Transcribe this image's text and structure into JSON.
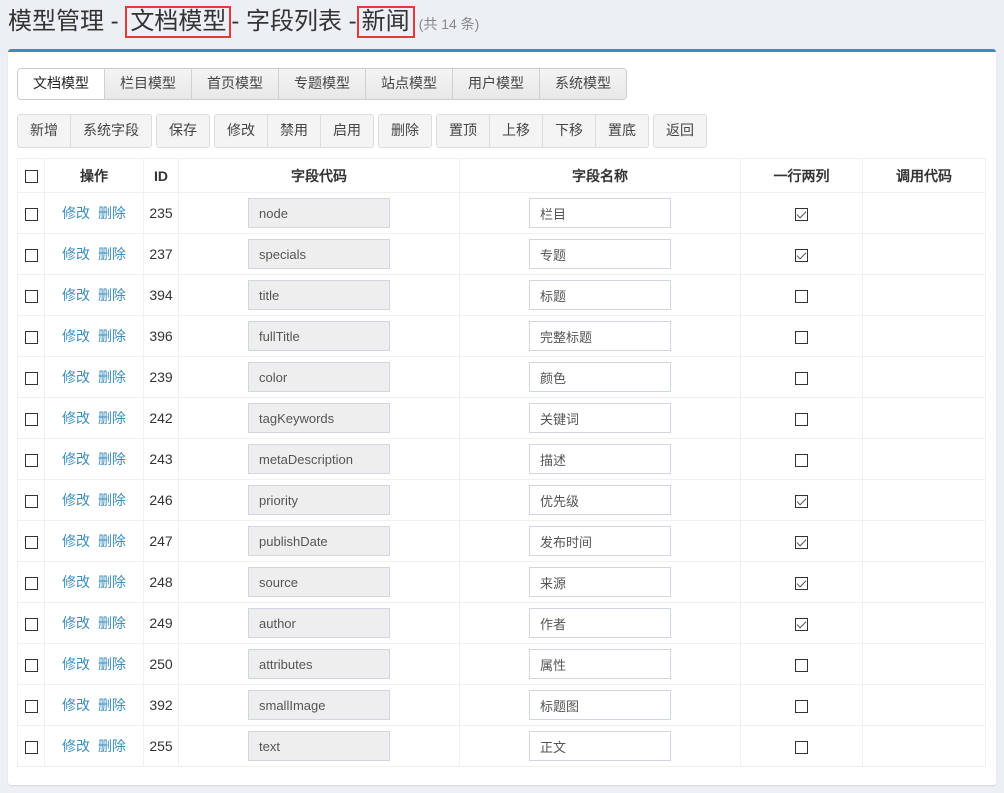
{
  "header": {
    "part1": "模型管理 - ",
    "model": "文档模型",
    "part2": "- 字段列表 -",
    "channel": "新闻",
    "count": "(共 14 条)"
  },
  "tabs": [
    {
      "label": "文档模型",
      "active": true
    },
    {
      "label": "栏目模型",
      "active": false
    },
    {
      "label": "首页模型",
      "active": false
    },
    {
      "label": "专题模型",
      "active": false
    },
    {
      "label": "站点模型",
      "active": false
    },
    {
      "label": "用户模型",
      "active": false
    },
    {
      "label": "系统模型",
      "active": false
    }
  ],
  "toolbar": {
    "groups": [
      [
        {
          "label": "新增",
          "name": "add-button"
        },
        {
          "label": "系统字段",
          "name": "system-fields-button"
        }
      ],
      [
        {
          "label": "保存",
          "name": "save-button"
        }
      ],
      [
        {
          "label": "修改",
          "name": "edit-button"
        },
        {
          "label": "禁用",
          "name": "disable-button"
        },
        {
          "label": "启用",
          "name": "enable-button"
        }
      ],
      [
        {
          "label": "删除",
          "name": "delete-button"
        }
      ],
      [
        {
          "label": "置顶",
          "name": "move-top-button"
        },
        {
          "label": "上移",
          "name": "move-up-button"
        },
        {
          "label": "下移",
          "name": "move-down-button"
        },
        {
          "label": "置底",
          "name": "move-bottom-button"
        }
      ],
      [
        {
          "label": "返回",
          "name": "back-button"
        }
      ]
    ]
  },
  "table": {
    "columns": [
      "",
      "操作",
      "ID",
      "字段代码",
      "字段名称",
      "一行两列",
      "调用代码"
    ],
    "edit_label": "修改",
    "delete_label": "删除",
    "rows": [
      {
        "id": "235",
        "code": "node",
        "name": "栏目",
        "double_col": true
      },
      {
        "id": "237",
        "code": "specials",
        "name": "专题",
        "double_col": true
      },
      {
        "id": "394",
        "code": "title",
        "name": "标题",
        "double_col": false
      },
      {
        "id": "396",
        "code": "fullTitle",
        "name": "完整标题",
        "double_col": false
      },
      {
        "id": "239",
        "code": "color",
        "name": "颜色",
        "double_col": false
      },
      {
        "id": "242",
        "code": "tagKeywords",
        "name": "关键词",
        "double_col": false
      },
      {
        "id": "243",
        "code": "metaDescription",
        "name": "描述",
        "double_col": false
      },
      {
        "id": "246",
        "code": "priority",
        "name": "优先级",
        "double_col": true
      },
      {
        "id": "247",
        "code": "publishDate",
        "name": "发布时间",
        "double_col": true
      },
      {
        "id": "248",
        "code": "source",
        "name": "来源",
        "double_col": true
      },
      {
        "id": "249",
        "code": "author",
        "name": "作者",
        "double_col": true
      },
      {
        "id": "250",
        "code": "attributes",
        "name": "属性",
        "double_col": false
      },
      {
        "id": "392",
        "code": "smallImage",
        "name": "标题图",
        "double_col": false
      },
      {
        "id": "255",
        "code": "text",
        "name": "正文",
        "double_col": false
      }
    ]
  }
}
